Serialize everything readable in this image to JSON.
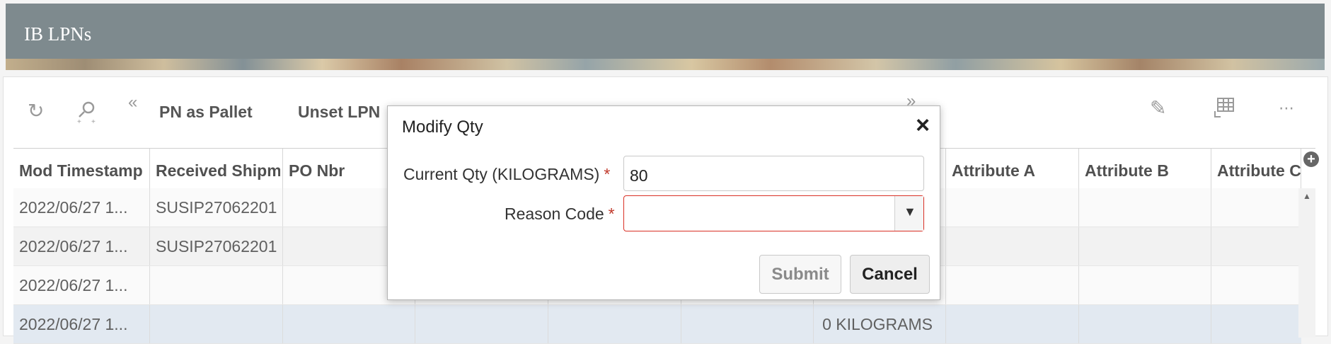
{
  "header": {
    "title": "IB LPNs"
  },
  "toolbar": {
    "items": [
      "PN as Pallet",
      "Unset LPN"
    ]
  },
  "grid": {
    "columns": [
      "Mod Timestamp",
      "Received Shipm",
      "PO Nbr",
      "",
      "",
      "",
      "",
      "Attribute A",
      "Attribute B",
      "Attribute C"
    ],
    "rows": [
      {
        "mod": "2022/06/27 1...",
        "shipment": "SUSIP27062201",
        "qty": ""
      },
      {
        "mod": "2022/06/27 1...",
        "shipment": "SUSIP27062201",
        "qty": ""
      },
      {
        "mod": "2022/06/27 1...",
        "shipment": "",
        "qty": ""
      },
      {
        "mod": "2022/06/27 1...",
        "shipment": "",
        "qty": "0 KILOGRAMS"
      }
    ]
  },
  "dialog": {
    "title": "Modify Qty",
    "current_qty_label": "Current Qty (KILOGRAMS)",
    "current_qty_value": "80",
    "reason_label": "Reason Code",
    "required_mark": "*",
    "submit": "Submit",
    "cancel": "Cancel"
  }
}
